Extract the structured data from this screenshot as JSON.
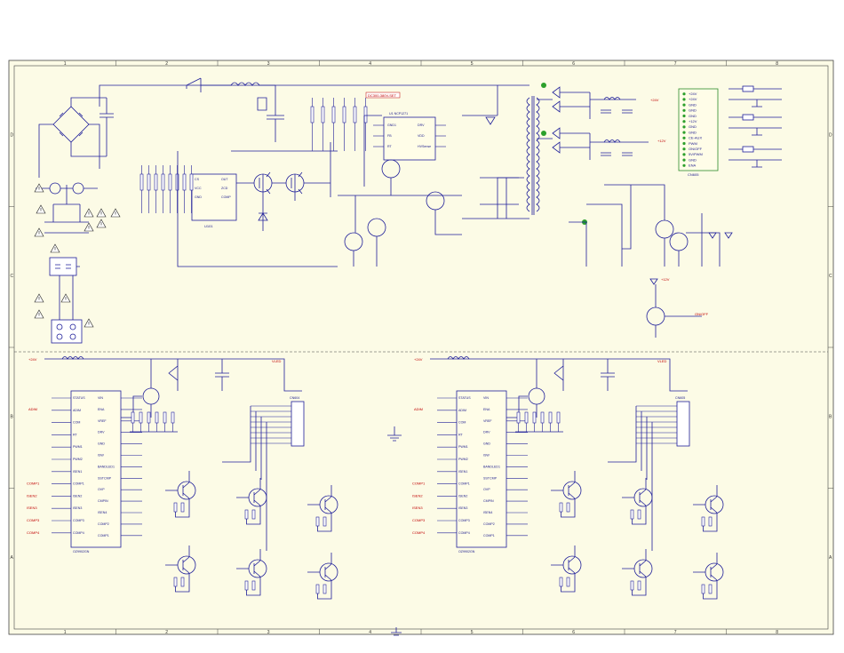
{
  "sheet": {
    "background": "#fcfbe6",
    "wire_color": "#1f1f9a",
    "label_color": "#c00000",
    "grid_cols": [
      "1",
      "2",
      "3",
      "4",
      "5",
      "6",
      "7",
      "8"
    ],
    "grid_rows": [
      "D",
      "C",
      "B",
      "A"
    ]
  },
  "title_banner": "DC300-380V-SET",
  "psu": {
    "ic_u1": {
      "name": "U1  NCP1271",
      "pins_left": [
        "GND1",
        "FB",
        "RT"
      ],
      "pins_right": [
        "DRV",
        "VDD",
        "HVSense"
      ]
    },
    "ic_u2": {
      "name": "U100",
      "pins_left": [
        "VCC",
        "GND",
        "FB"
      ],
      "pins_right": [
        "DRV",
        "CS",
        "HV"
      ]
    },
    "connector": {
      "name": "CN605",
      "pins": [
        "+24V",
        "+24V",
        "GND",
        "GND",
        "GND",
        "+12V",
        "GND",
        "GND",
        "CE-AUX",
        "PWM",
        "ON/OFF",
        "5V/PWM",
        "GND",
        "ENA"
      ]
    },
    "labels": [
      "+24V",
      "+12V",
      "VDD",
      "ON/OFF",
      "5V/STB",
      "D-PDA",
      "PC817"
    ]
  },
  "led_drivers": [
    {
      "ic_name": "OZ9902GN",
      "top_label": "+24V",
      "left_pins": [
        "STATUS",
        "ADIM",
        "COM",
        "RT",
        "PWM1",
        "PWM2",
        "ISEN1",
        "COMP1",
        "ISEN2",
        "ISEN3",
        "COMP3",
        "COMP4"
      ],
      "right_pins": [
        "VIN",
        "ENA",
        "VREF",
        "DRV",
        "GND",
        "ISW",
        "BANDLED1",
        "SSTCMP",
        "OVP",
        "CMPIN",
        "ISEN4",
        "COMP2",
        "COMP1"
      ],
      "connector": "CN604",
      "labels": [
        "ENA",
        "COMP1",
        "COMP2",
        "COMP3",
        "COMP4",
        "ISEN1",
        "ISEN2",
        "ISEN3",
        "ISEN4",
        "VLED",
        "ADIM"
      ]
    },
    {
      "ic_name": "OZ9902GN",
      "top_label": "+24V",
      "left_pins": [
        "STATUS",
        "ADIM",
        "COM",
        "RT",
        "PWM1",
        "PWM2",
        "ISEN1",
        "COMP1",
        "ISEN2",
        "ISEN3",
        "COMP3",
        "COMP4"
      ],
      "right_pins": [
        "VIN",
        "ENA",
        "VREF",
        "DRV",
        "GND",
        "ISW",
        "BANDLED1",
        "SSTCMP",
        "OVP",
        "CMPIN",
        "ISEN4",
        "COMP2",
        "COMP1"
      ],
      "connector": "CN605",
      "labels": [
        "ENA",
        "COMP1",
        "COMP2",
        "COMP3",
        "COMP4",
        "ISEN1",
        "ISEN2",
        "ISEN3",
        "ISEN4",
        "VLED",
        "ADIM"
      ]
    }
  ]
}
